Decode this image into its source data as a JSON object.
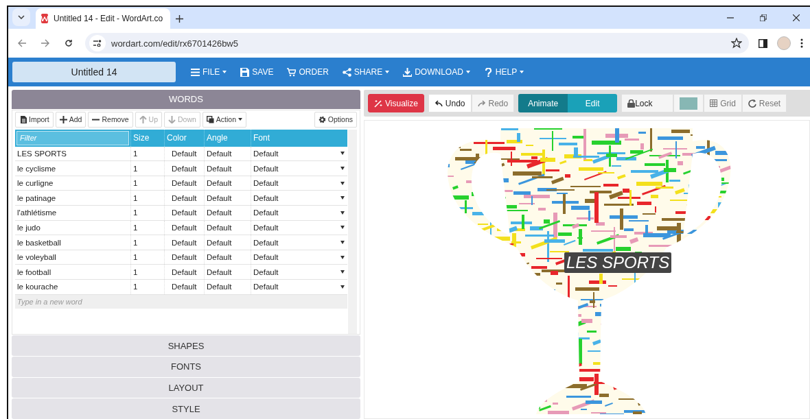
{
  "browser": {
    "tab_title": "Untitled 14 - Edit - WordArt.co",
    "url": "wordart.com/edit/rx6701426bw5"
  },
  "app": {
    "title": "Untitled 14",
    "menu": [
      {
        "label": "FILE",
        "dropdown": true
      },
      {
        "label": "SAVE",
        "dropdown": false
      },
      {
        "label": "ORDER",
        "dropdown": false
      },
      {
        "label": "SHARE",
        "dropdown": true
      },
      {
        "label": "DOWNLOAD",
        "dropdown": true
      },
      {
        "label": "HELP",
        "dropdown": true
      }
    ]
  },
  "words_panel": {
    "title": "WORDS",
    "toolbar": [
      {
        "label": "Import",
        "disabled": false
      },
      {
        "label": "Add",
        "disabled": false
      },
      {
        "label": "Remove",
        "disabled": false
      },
      {
        "label": "Up",
        "disabled": true
      },
      {
        "label": "Down",
        "disabled": true
      },
      {
        "label": "Action",
        "disabled": false
      }
    ],
    "options": "Options",
    "filter": {
      "placeholder": "Filter"
    },
    "columns": [
      "Size",
      "Color",
      "Angle",
      "Font"
    ],
    "rows": [
      {
        "word": "LES SPORTS",
        "size": "1",
        "color_setting": "Default",
        "angle": "Default",
        "font": "Default"
      },
      {
        "word": "le cyclisme",
        "size": "1",
        "color_setting": "Default",
        "angle": "Default",
        "font": "Default"
      },
      {
        "word": "le curligne",
        "size": "1",
        "color_setting": "Default",
        "angle": "Default",
        "font": "Default"
      },
      {
        "word": "le patinage",
        "size": "1",
        "color_setting": "Default",
        "angle": "Default",
        "font": "Default"
      },
      {
        "word": "l'athlétisme",
        "size": "1",
        "color_setting": "Default",
        "angle": "Default",
        "font": "Default"
      },
      {
        "word": "le judo",
        "size": "1",
        "color_setting": "Default",
        "angle": "Default",
        "font": "Default"
      },
      {
        "word": "le basketball",
        "size": "1",
        "color_setting": "Default",
        "angle": "Default",
        "font": "Default"
      },
      {
        "word": "le voleyball",
        "size": "1",
        "color_setting": "Default",
        "angle": "Default",
        "font": "Default"
      },
      {
        "word": "le football",
        "size": "1",
        "color_setting": "Default",
        "angle": "Default",
        "font": "Default"
      },
      {
        "word": "le kourache",
        "size": "1",
        "color_setting": "Default",
        "angle": "Default",
        "font": "Default"
      }
    ],
    "new_word": {
      "placeholder": "Type in a new word"
    }
  },
  "sections": [
    "SHAPES",
    "FONTS",
    "LAYOUT",
    "STYLE"
  ],
  "canvas_toolbar": {
    "visualize": "Visualize",
    "undo": {
      "label": "Undo",
      "disabled": false
    },
    "redo": {
      "label": "Redo",
      "disabled": true
    },
    "modes": [
      {
        "label": "Animate",
        "selected": true
      },
      {
        "label": "Edit",
        "selected": false
      }
    ],
    "lock": "Lock",
    "grid": "Grid",
    "reset": "Reset"
  },
  "canvas": {
    "tooltip": "LES SPORTS"
  }
}
